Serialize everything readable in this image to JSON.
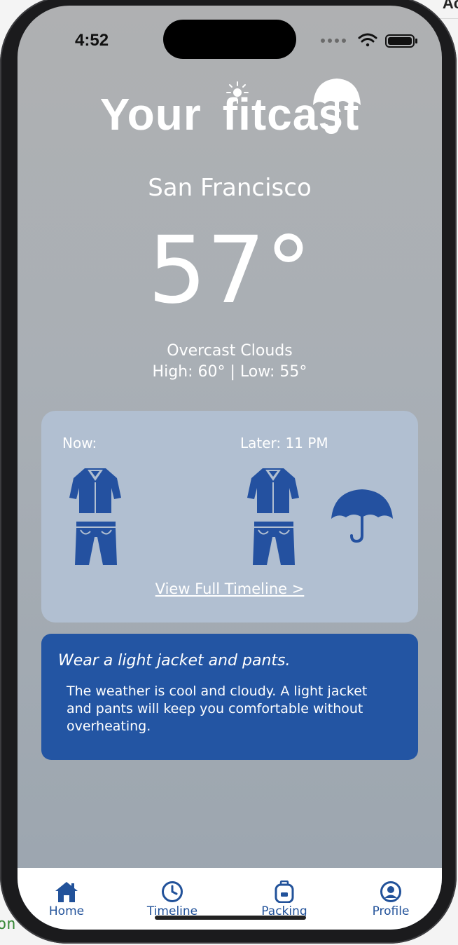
{
  "corner_text": "Ac",
  "side_text": "on",
  "status_bar": {
    "time": "4:52",
    "icons": [
      "signal-dots-icon",
      "wifi-icon",
      "battery-icon"
    ]
  },
  "header": {
    "title_part1": "Your",
    "title_part2": "fitcast"
  },
  "weather": {
    "city": "San Francisco",
    "temperature": "57°",
    "condition": "Overcast Clouds",
    "high_low": "High: 60° | Low: 55°"
  },
  "outfit": {
    "now_label": "Now:",
    "later_label": "Later: 11 PM",
    "now_items": [
      "jacket-icon",
      "pants-icon"
    ],
    "later_items": [
      "jacket-icon",
      "pants-icon",
      "umbrella-icon"
    ],
    "timeline_link": "View Full Timeline >"
  },
  "advice": {
    "title": "Wear a light jacket and pants.",
    "body": "The weather is cool and cloudy. A light jacket and pants will keep you comfortable without overheating."
  },
  "tabbar": {
    "tabs": [
      {
        "label": "Home",
        "icon": "home-icon"
      },
      {
        "label": "Timeline",
        "icon": "clock-icon"
      },
      {
        "label": "Packing",
        "icon": "backpack-icon"
      },
      {
        "label": "Profile",
        "icon": "user-circle-icon"
      }
    ]
  },
  "colors": {
    "accent": "#2355a3",
    "card": "#b1bfd1",
    "background_top": "#afb0b2",
    "background_bottom": "#9ba5af"
  }
}
